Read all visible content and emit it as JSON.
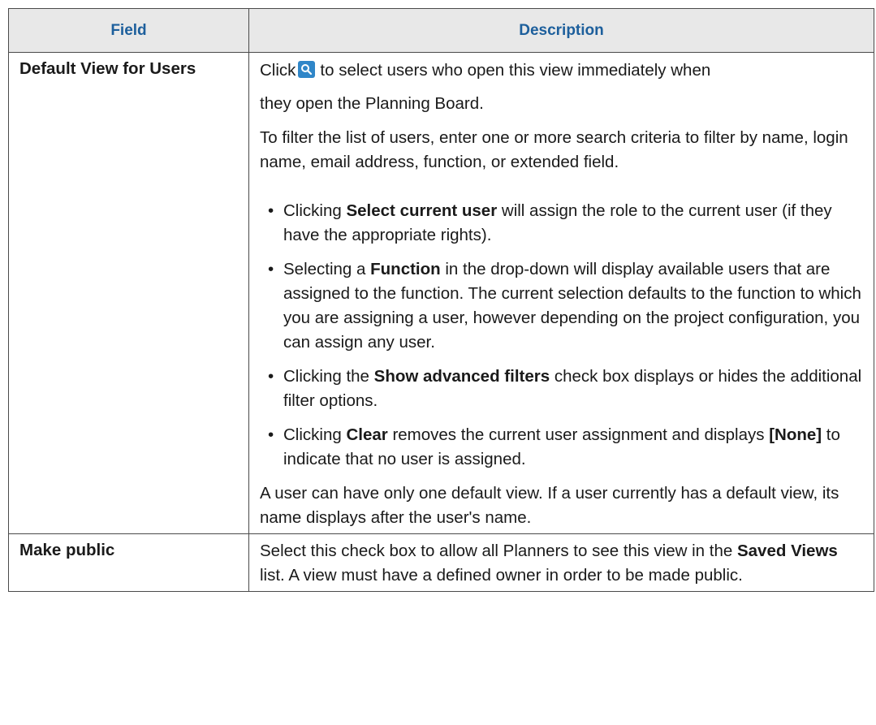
{
  "table": {
    "headers": {
      "field": "Field",
      "description": "Description"
    },
    "rows": [
      {
        "field": "Default View for Users",
        "desc": {
          "intro_before_icon": "Click",
          "intro_after_icon": "to select users who open this view immediately when",
          "intro_line2": "they open the Planning Board.",
          "filter_para": "To filter the list of users, enter one or more search criteria to filter by name, login name, email address, function, or extended field.",
          "bullets": [
            {
              "pre": "Clicking ",
              "bold": "Select current user",
              "post": " will assign the role to the current user (if they have the appropriate rights)."
            },
            {
              "pre": "Selecting a ",
              "bold": "Function",
              "post": " in the drop-down will display available users that are assigned to the function. The current selection defaults to the function to which you are assigning a user, however depending on the project configuration, you can assign any user."
            },
            {
              "pre": "Clicking the ",
              "bold": "Show advanced filters",
              "post": " check box displays or hides the additional filter options."
            },
            {
              "pre": "Clicking ",
              "bold": "Clear",
              "mid": " removes the current user assignment and displays ",
              "bold2": "[None]",
              "post": " to indicate that no user is assigned."
            }
          ],
          "closing_para": "A user can have only one default view. If a user currently has a default view, its name displays after the user's name."
        }
      },
      {
        "field": "Make public",
        "desc": {
          "pre": "Select this check box to allow all Planners to see this view in the ",
          "bold": "Saved Views",
          "post": " list. A view must have a defined owner in order to be made public."
        }
      }
    ]
  },
  "icons": {
    "search": "search-icon"
  },
  "colors": {
    "header_text": "#1d5f9c",
    "header_bg": "#e8e8e8",
    "icon_bg": "#2f86c8"
  }
}
